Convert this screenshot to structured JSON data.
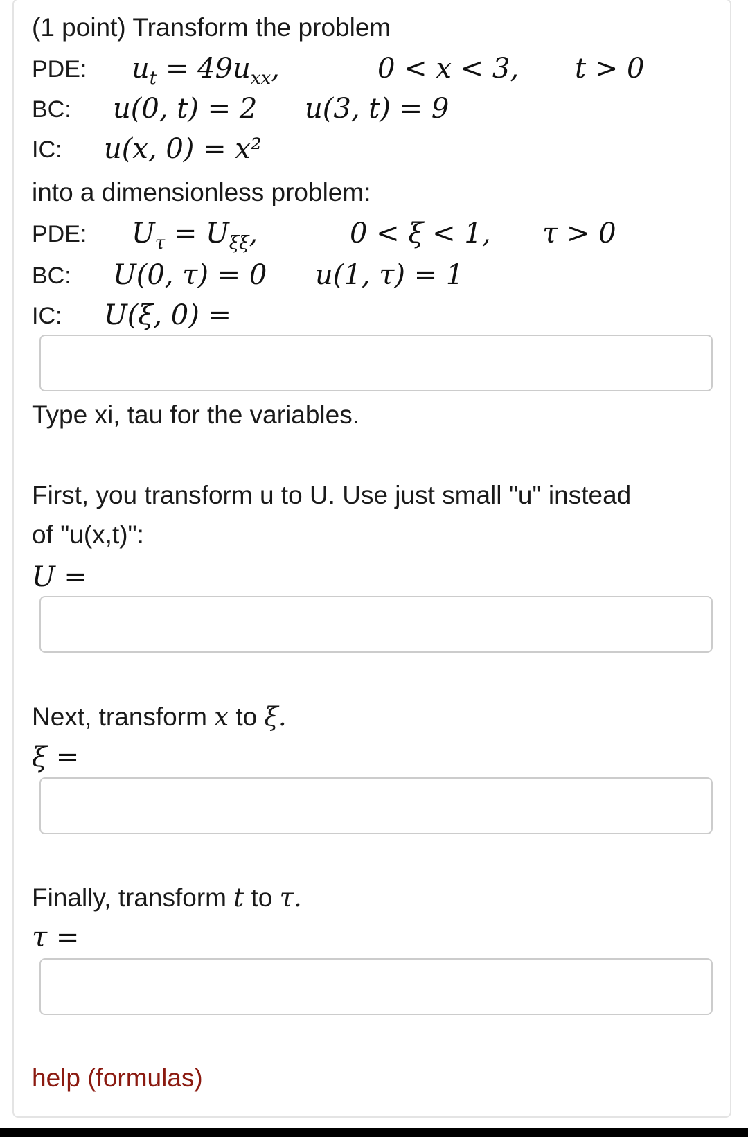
{
  "problem": {
    "intro": "(1 point) Transform the problem",
    "original": {
      "pde_label": "PDE:",
      "pde_eq": "uₜ = 49uₓₓ,",
      "pde_domain_x": "0 < x < 3,",
      "pde_domain_t": "t > 0",
      "bc_label": "BC:",
      "bc_left": "u(0, t) = 2",
      "bc_right": "u(3, t) = 9",
      "ic_label": "IC:",
      "ic_eq": "u(x, 0) = x²"
    },
    "middle": "into a dimensionless problem:",
    "dimensionless": {
      "pde_label": "PDE:",
      "pde_eq": "Uτ = Uξξ,",
      "pde_domain_xi": "0 < ξ < 1,",
      "pde_domain_tau": "τ > 0",
      "bc_label": "BC:",
      "bc_left": "U(0, τ) = 0",
      "bc_right": "u(1, τ) = 1",
      "ic_label": "IC:",
      "ic_eq": "U(ξ, 0) ="
    }
  },
  "instructions": {
    "variables_hint": "Type xi, tau for the variables.",
    "step_u_line1": "First, you transform u to U. Use just small \"u\" instead",
    "step_u_line2": "of \"u(x,t)\":",
    "u_eq": "U =",
    "step_x_prefix": "Next, transform",
    "step_x_var": "x",
    "step_x_mid": "to",
    "step_x_target": "ξ.",
    "xi_eq": "ξ =",
    "step_t_prefix": "Finally, transform",
    "step_t_var": "t",
    "step_t_mid": "to",
    "step_t_target": "τ.",
    "tau_eq": "τ ="
  },
  "inputs": {
    "ic_answer": "",
    "u_answer": "",
    "xi_answer": "",
    "tau_answer": ""
  },
  "help": {
    "label": "help (formulas)"
  },
  "colors": {
    "link": "#8b1a10",
    "border": "#cccccc"
  }
}
